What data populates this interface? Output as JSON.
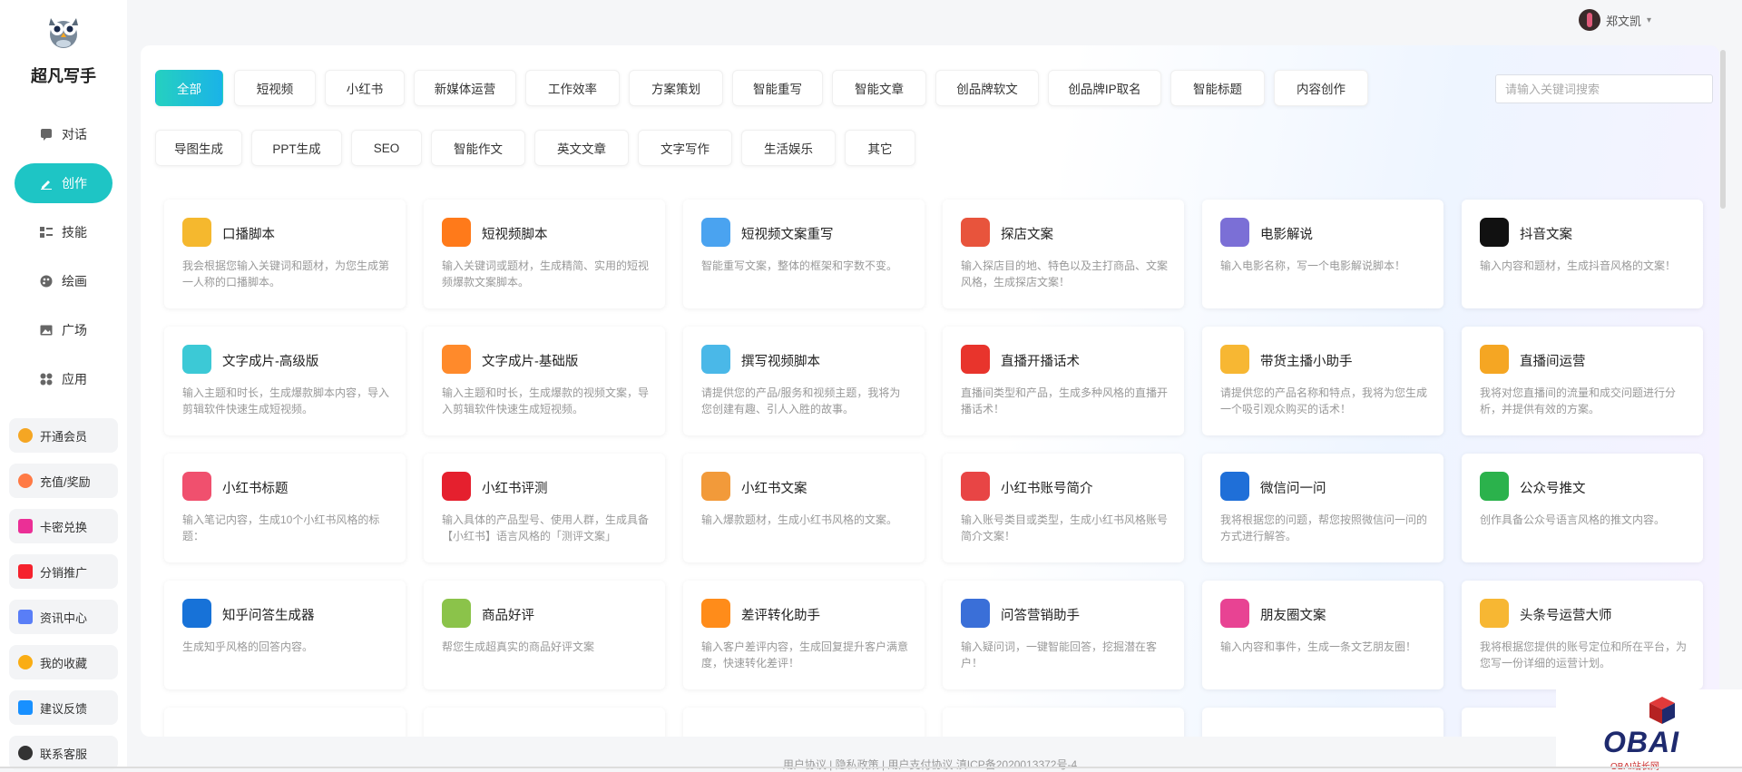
{
  "app": {
    "name": "超凡写手"
  },
  "sidebar": {
    "nav": [
      {
        "label": "对话",
        "icon": "chat-icon"
      },
      {
        "label": "创作",
        "icon": "pen-icon",
        "active": true
      },
      {
        "label": "技能",
        "icon": "list-icon"
      },
      {
        "label": "绘画",
        "icon": "palette-icon"
      },
      {
        "label": "广场",
        "icon": "image-icon"
      },
      {
        "label": "应用",
        "icon": "apps-icon"
      }
    ],
    "buttons": [
      {
        "label": "开通会员",
        "icon": "vip-icon",
        "color": "#f5a623"
      },
      {
        "label": "充值/奖励",
        "icon": "recharge-icon",
        "color": "#ff7a45"
      },
      {
        "label": "卡密兑换",
        "icon": "card-icon",
        "color": "#eb2f96"
      },
      {
        "label": "分销推广",
        "icon": "share-icon",
        "color": "#f5222d"
      },
      {
        "label": "资讯中心",
        "icon": "news-icon",
        "color": "#597ef7"
      },
      {
        "label": "我的收藏",
        "icon": "star-icon",
        "color": "#faad14"
      },
      {
        "label": "建议反馈",
        "icon": "feedback-icon",
        "color": "#1890ff"
      },
      {
        "label": "联系客服",
        "icon": "headset-icon",
        "color": "#333333"
      }
    ]
  },
  "user": {
    "name": "郑文凯"
  },
  "tabs": {
    "row1": [
      "全部",
      "短视频",
      "小红书",
      "新媒体运营",
      "工作效率",
      "方案策划",
      "智能重写",
      "智能文章",
      "创品牌软文",
      "创品牌IP取名",
      "智能标题",
      "内容创作"
    ],
    "row2": [
      "导图生成",
      "PPT生成",
      "SEO",
      "智能作文",
      "英文文章",
      "文字写作",
      "生活娱乐",
      "其它"
    ],
    "active": "全部"
  },
  "search": {
    "placeholder": "请输入关键词搜索"
  },
  "cards": [
    {
      "title": "口播脚本",
      "desc": "我会根据您输入关键词和题材，为您生成第一人称的口播脚本。",
      "icon": "microphone-icon",
      "color": "#f5b82e"
    },
    {
      "title": "短视频脚本",
      "desc": "输入关键词或题材，生成精简、实用的短视频爆款文案脚本。",
      "icon": "video-play-icon",
      "color": "#ff7a1a"
    },
    {
      "title": "短视频文案重写",
      "desc": "智能重写文案，整体的框架和字数不变。",
      "icon": "eraser-icon",
      "color": "#4aa3f0"
    },
    {
      "title": "探店文案",
      "desc": "输入探店目的地、特色以及主打商品、文案风格，生成探店文案！",
      "icon": "shop-icon",
      "color": "#e8543c"
    },
    {
      "title": "电影解说",
      "desc": "输入电影名称，写一个电影解说脚本！",
      "icon": "film-icon",
      "color": "#7b6fd6"
    },
    {
      "title": "抖音文案",
      "desc": "输入内容和题材，生成抖音风格的文案！",
      "icon": "tiktok-icon",
      "color": "#111111"
    },
    {
      "title": "文字成片-高级版",
      "desc": "输入主题和时长，生成爆款脚本内容，导入剪辑软件快速生成短视频。",
      "icon": "clapperboard-icon",
      "color": "#3cc9d6"
    },
    {
      "title": "文字成片-基础版",
      "desc": "输入主题和时长，生成爆款的视频文案，导入剪辑软件快速生成短视频。",
      "icon": "video-icon",
      "color": "#ff8a2b"
    },
    {
      "title": "撰写视频脚本",
      "desc": "请提供您的产品/服务和视频主题，我将为您创建有趣、引人入胜的故事。",
      "icon": "camera-icon",
      "color": "#4ab8e8"
    },
    {
      "title": "直播开播话术",
      "desc": "直播间类型和产品，生成多种风格的直播开播话术！",
      "icon": "live-icon",
      "color": "#e8342c"
    },
    {
      "title": "带货主播小助手",
      "desc": "请提供您的产品名称和特点，我将为您生成一个吸引观众购买的话术！",
      "icon": "star-badge-icon",
      "color": "#f7b733"
    },
    {
      "title": "直播间运营",
      "desc": "我将对您直播间的流量和成交问题进行分析，并提供有效的方案。",
      "icon": "beer-icon",
      "color": "#f5a623"
    },
    {
      "title": "小红书标题",
      "desc": "输入笔记内容，生成10个小红书风格的标题：",
      "icon": "xiaohongshu-icon",
      "color": "#f0506e"
    },
    {
      "title": "小红书评测",
      "desc": "输入具体的产品型号、使用人群，生成具备【小红书】语言风格的「测评文案」",
      "icon": "xiaohongshu-logo-icon",
      "color": "#e5202e"
    },
    {
      "title": "小红书文案",
      "desc": "输入爆款题材，生成小红书风格的文案。",
      "icon": "notebook-icon",
      "color": "#f29a3a"
    },
    {
      "title": "小红书账号简介",
      "desc": "输入账号类目或类型，生成小红书风格账号简介文案！",
      "icon": "profile-card-icon",
      "color": "#e84545"
    },
    {
      "title": "微信问一问",
      "desc": "我将根据您的问题，帮您按照微信问一问的方式进行解答。",
      "icon": "question-icon",
      "color": "#1f6fd8"
    },
    {
      "title": "公众号推文",
      "desc": "创作具备公众号语言风格的推文内容。",
      "icon": "wechat-icon",
      "color": "#2bb24c"
    },
    {
      "title": "知乎问答生成器",
      "desc": "生成知乎风格的回答内容。",
      "icon": "zhihu-icon",
      "color": "#1772d8"
    },
    {
      "title": "商品好评",
      "desc": "帮您生成超真实的商品好评文案",
      "icon": "shopping-bag-icon",
      "color": "#8bc34a"
    },
    {
      "title": "差评转化助手",
      "desc": "输入客户差评内容，生成回复提升客户满意度，快速转化差评！",
      "icon": "convert-icon",
      "color": "#ff8c1a"
    },
    {
      "title": "问答营销助手",
      "desc": "输入疑问词，一键智能回答，挖掘潜在客户！",
      "icon": "qa-icon",
      "color": "#3a6fd8"
    },
    {
      "title": "朋友圈文案",
      "desc": "输入内容和事件，生成一条文艺朋友圈！",
      "icon": "aperture-icon",
      "color": "#e84393"
    },
    {
      "title": "头条号运营大师",
      "desc": "我将根据您提供的账号定位和所在平台，为您写一份详细的运营计划。",
      "icon": "medal-icon",
      "color": "#f7b733"
    }
  ],
  "footer": {
    "text": "用户协议 | 隐私政策 | 用户支付协议   滇ICP备2020013372号-4"
  },
  "watermark": {
    "title": "OBAI",
    "subtitle": "OBAI站长网"
  }
}
